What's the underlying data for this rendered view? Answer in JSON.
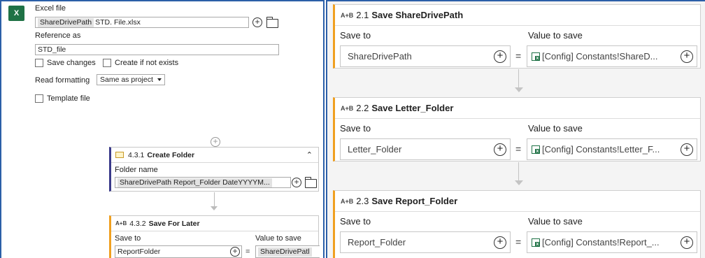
{
  "excel_activity": {
    "label_excel_file": "Excel file",
    "file_chip": "ShareDrivePath",
    "file_suffix": "STD. File.xlsx",
    "label_reference": "Reference as",
    "reference_value": "STD_file",
    "save_changes": "Save changes",
    "create_if_not_exists": "Create if not exists",
    "label_read_formatting": "Read formatting",
    "read_formatting_value": "Same as project",
    "template_file": "Template file",
    "badge": "X"
  },
  "create_folder": {
    "number": "4.3.1",
    "title": "Create Folder",
    "label_folder_name": "Folder name",
    "folder_value": "ShareDrivePath  Report_Folder  DateYYYYM..."
  },
  "save_for_later": {
    "icon": "A+B",
    "number": "4.3.2",
    "title": "Save For Later",
    "label_save_to": "Save to",
    "label_value": "Value to save",
    "save_to_value": "ReportFolder",
    "value_chip": "ShareDrivePatl",
    "eq": "="
  },
  "assigns": [
    {
      "icon": "A+B",
      "number": "2.1",
      "title": "Save ShareDrivePath",
      "label_save_to": "Save to",
      "label_value": "Value to save",
      "save_to": "ShareDrivePath",
      "value": "[Config] Constants!ShareD...",
      "eq": "="
    },
    {
      "icon": "A+B",
      "number": "2.2",
      "title": "Save Letter_Folder",
      "label_save_to": "Save to",
      "label_value": "Value to save",
      "save_to": "Letter_Folder",
      "value": "[Config] Constants!Letter_F...",
      "eq": "="
    },
    {
      "icon": "A+B",
      "number": "2.3",
      "title": "Save Report_Folder",
      "label_save_to": "Save to",
      "label_value": "Value to save",
      "save_to": "Report_Folder",
      "value": "[Config] Constants!Report_...",
      "eq": "="
    }
  ],
  "colors": {
    "panel_border": "#2b5fa8",
    "assign_accent": "#f0a020",
    "excel_green": "#1f7246"
  }
}
